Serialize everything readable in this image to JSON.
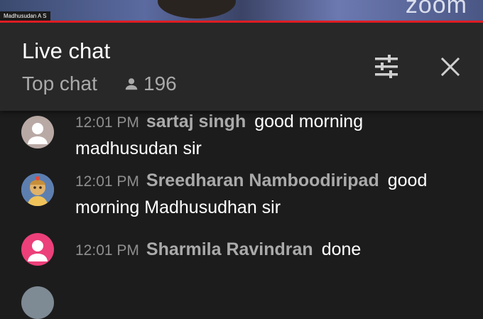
{
  "video": {
    "speaker_label": "Madhusudan A S",
    "watermark": "zoom"
  },
  "header": {
    "title": "Live chat",
    "subtitle": "Top chat",
    "viewer_count": "196",
    "icons": {
      "viewers": "person-icon",
      "filter": "tune-icon",
      "close": "close-icon"
    }
  },
  "messages": [
    {
      "time": "12:01 PM",
      "author": "sartaj singh",
      "text": "good morning madhusudan sir",
      "avatar": "default-person"
    },
    {
      "time": "12:01 PM",
      "author": "Sreedharan Namboodiripad",
      "text": "good morning Madhusudhan sir",
      "avatar": "illustration"
    },
    {
      "time": "12:01 PM",
      "author": "Sharmila Ravindran",
      "text": "done",
      "avatar": "default-person"
    }
  ],
  "colors": {
    "background": "#1c1c1c",
    "header_bg": "#282828",
    "accent_red": "#e61e25",
    "author": "#aaaaaa",
    "timestamp": "#8e8e8e",
    "avatar_1": "#b9a9a5",
    "avatar_3": "#ec407a"
  }
}
